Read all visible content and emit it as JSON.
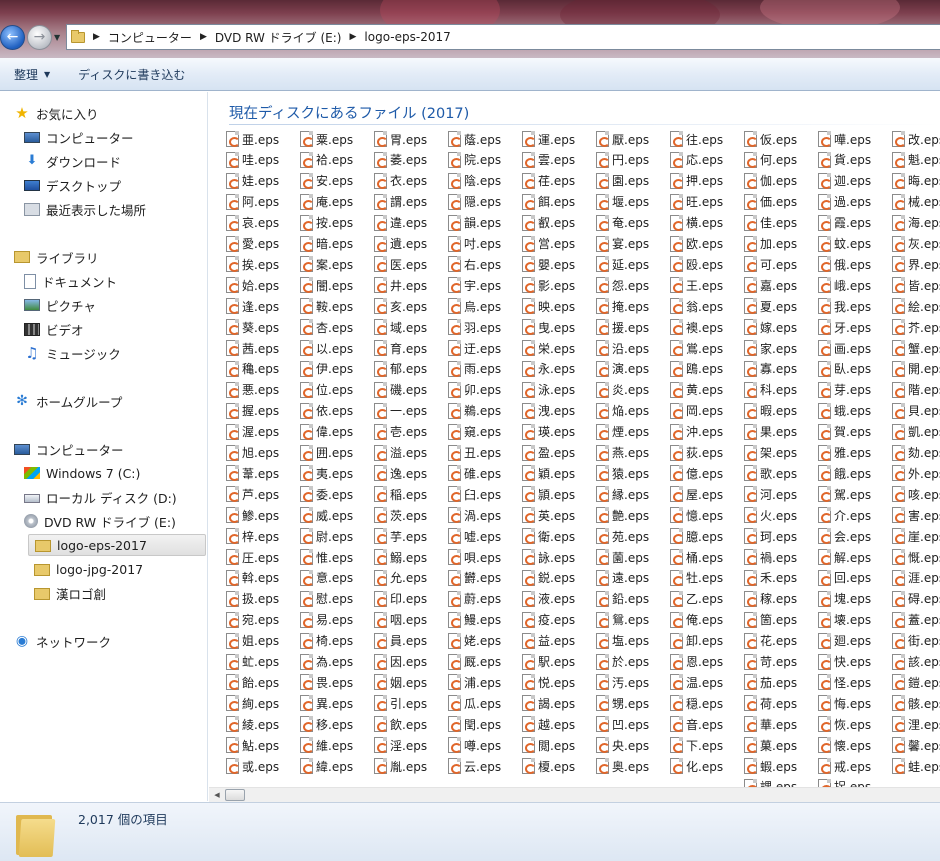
{
  "address": {
    "crumbs": [
      "コンピューター",
      "DVD RW ドライブ (E:)",
      "logo-eps-2017"
    ]
  },
  "toolbar": {
    "organize_label": "整理",
    "burn_label": "ディスクに書き込む"
  },
  "sidebar": {
    "favorites_header": "お気に入り",
    "favorites": [
      "コンピューター",
      "ダウンロード",
      "デスクトップ",
      "最近表示した場所"
    ],
    "libraries_header": "ライブラリ",
    "libraries": [
      "ドキュメント",
      "ピクチャ",
      "ビデオ",
      "ミュージック"
    ],
    "homegroup": "ホームグループ",
    "computer_header": "コンピューター",
    "computer_items": [
      "Windows 7 (C:)",
      "ローカル ディスク (D:)",
      "DVD RW ドライブ (E:)"
    ],
    "dvd_folders": [
      "logo-eps-2017",
      "logo-jpg-2017",
      "漢ロゴ創"
    ],
    "network": "ネットワーク"
  },
  "main": {
    "title": "現在ディスクにあるファイル (2017)"
  },
  "files": [
    [
      "亜.eps",
      "哇.eps",
      "娃.eps",
      "阿.eps",
      "哀.eps",
      "愛.eps",
      "挨.eps",
      "姶.eps",
      "逢.eps",
      "葵.eps",
      "茜.eps",
      "穐.eps",
      "悪.eps",
      "握.eps",
      "渥.eps",
      "旭.eps",
      "葦.eps",
      "芦.eps",
      "鯵.eps",
      "梓.eps",
      "圧.eps",
      "斡.eps",
      "扱.eps",
      "宛.eps",
      "姐.eps",
      "虻.eps",
      "飴.eps",
      "絢.eps",
      "綾.eps",
      "鮎.eps",
      "或.eps"
    ],
    [
      "粟.eps",
      "袷.eps",
      "安.eps",
      "庵.eps",
      "按.eps",
      "暗.eps",
      "案.eps",
      "闇.eps",
      "鞍.eps",
      "杏.eps",
      "以.eps",
      "伊.eps",
      "位.eps",
      "依.eps",
      "偉.eps",
      "囲.eps",
      "夷.eps",
      "委.eps",
      "威.eps",
      "尉.eps",
      "惟.eps",
      "意.eps",
      "慰.eps",
      "易.eps",
      "椅.eps",
      "為.eps",
      "畏.eps",
      "異.eps",
      "移.eps",
      "維.eps",
      "緯.eps"
    ],
    [
      "胃.eps",
      "萎.eps",
      "衣.eps",
      "謂.eps",
      "違.eps",
      "遺.eps",
      "医.eps",
      "井.eps",
      "亥.eps",
      "域.eps",
      "育.eps",
      "郁.eps",
      "磯.eps",
      "一.eps",
      "壱.eps",
      "溢.eps",
      "逸.eps",
      "稲.eps",
      "茨.eps",
      "芋.eps",
      "鰯.eps",
      "允.eps",
      "印.eps",
      "咽.eps",
      "員.eps",
      "因.eps",
      "姻.eps",
      "引.eps",
      "飲.eps",
      "淫.eps",
      "胤.eps"
    ],
    [
      "蔭.eps",
      "院.eps",
      "陰.eps",
      "隠.eps",
      "韻.eps",
      "吋.eps",
      "右.eps",
      "宇.eps",
      "烏.eps",
      "羽.eps",
      "迂.eps",
      "雨.eps",
      "卯.eps",
      "鵜.eps",
      "窺.eps",
      "丑.eps",
      "碓.eps",
      "臼.eps",
      "渦.eps",
      "嘘.eps",
      "唄.eps",
      "欝.eps",
      "蔚.eps",
      "鰻.eps",
      "姥.eps",
      "厩.eps",
      "浦.eps",
      "瓜.eps",
      "閏.eps",
      "噂.eps",
      "云.eps"
    ],
    [
      "運.eps",
      "雲.eps",
      "荏.eps",
      "餌.eps",
      "叡.eps",
      "営.eps",
      "嬰.eps",
      "影.eps",
      "映.eps",
      "曳.eps",
      "栄.eps",
      "永.eps",
      "泳.eps",
      "洩.eps",
      "瑛.eps",
      "盈.eps",
      "穎.eps",
      "頴.eps",
      "英.eps",
      "衛.eps",
      "詠.eps",
      "鋭.eps",
      "液.eps",
      "疫.eps",
      "益.eps",
      "駅.eps",
      "悦.eps",
      "謁.eps",
      "越.eps",
      "閲.eps",
      "榎.eps"
    ],
    [
      "厭.eps",
      "円.eps",
      "園.eps",
      "堰.eps",
      "奄.eps",
      "宴.eps",
      "延.eps",
      "怨.eps",
      "掩.eps",
      "援.eps",
      "沿.eps",
      "演.eps",
      "炎.eps",
      "焔.eps",
      "煙.eps",
      "燕.eps",
      "猿.eps",
      "縁.eps",
      "艶.eps",
      "苑.eps",
      "薗.eps",
      "遠.eps",
      "鉛.eps",
      "鴛.eps",
      "塩.eps",
      "於.eps",
      "汚.eps",
      "甥.eps",
      "凹.eps",
      "央.eps",
      "奥.eps"
    ],
    [
      "往.eps",
      "応.eps",
      "押.eps",
      "旺.eps",
      "横.eps",
      "欧.eps",
      "殴.eps",
      "王.eps",
      "翁.eps",
      "襖.eps",
      "鴬.eps",
      "鴎.eps",
      "黄.eps",
      "岡.eps",
      "沖.eps",
      "荻.eps",
      "億.eps",
      "屋.eps",
      "憶.eps",
      "臆.eps",
      "桶.eps",
      "牡.eps",
      "乙.eps",
      "俺.eps",
      "卸.eps",
      "恩.eps",
      "温.eps",
      "穏.eps",
      "音.eps",
      "下.eps",
      "化.eps"
    ],
    [
      "仮.eps",
      "何.eps",
      "伽.eps",
      "価.eps",
      "佳.eps",
      "加.eps",
      "可.eps",
      "嘉.eps",
      "夏.eps",
      "嫁.eps",
      "家.eps",
      "寡.eps",
      "科.eps",
      "暇.eps",
      "果.eps",
      "架.eps",
      "歌.eps",
      "河.eps",
      "火.eps",
      "珂.eps",
      "禍.eps",
      "禾.eps",
      "稼.eps",
      "箇.eps",
      "花.eps",
      "苛.eps",
      "茄.eps",
      "荷.eps",
      "華.eps",
      "菓.eps",
      "蝦.eps",
      "課.eps"
    ],
    [
      "嘩.eps",
      "貨.eps",
      "迦.eps",
      "過.eps",
      "霞.eps",
      "蚊.eps",
      "俄.eps",
      "峨.eps",
      "我.eps",
      "牙.eps",
      "画.eps",
      "臥.eps",
      "芽.eps",
      "蛾.eps",
      "賀.eps",
      "雅.eps",
      "餓.eps",
      "駕.eps",
      "介.eps",
      "会.eps",
      "解.eps",
      "回.eps",
      "塊.eps",
      "壊.eps",
      "廻.eps",
      "快.eps",
      "怪.eps",
      "悔.eps",
      "恢.eps",
      "懐.eps",
      "戒.eps",
      "拐.eps"
    ],
    [
      "改.eps",
      "魁.eps",
      "晦.eps",
      "械.eps",
      "海.eps",
      "灰.eps",
      "界.eps",
      "皆.eps",
      "絵.eps",
      "芥.eps",
      "蟹.eps",
      "開.eps",
      "階.eps",
      "貝.eps",
      "凱.eps",
      "劾.eps",
      "外.eps",
      "咳.eps",
      "害.eps",
      "崖.eps",
      "慨.eps",
      "涯.eps",
      "碍.eps",
      "蓋.eps",
      "街.eps",
      "該.eps",
      "鎧.eps",
      "骸.eps",
      "浬.eps",
      "馨.eps",
      "蛙.eps"
    ]
  ],
  "status": {
    "item_count": "2,017 個の項目"
  }
}
